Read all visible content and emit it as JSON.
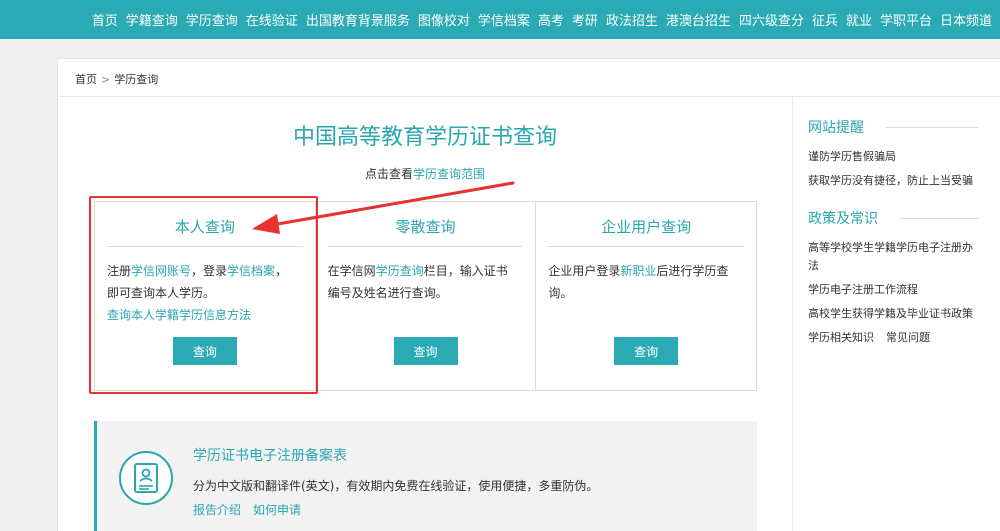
{
  "topnav": {
    "items": [
      "首页",
      "学籍查询",
      "学历查询",
      "在线验证",
      "出国教育背景服务",
      "图像校对",
      "学信档案",
      "高考",
      "考研",
      "政法招生",
      "港澳台招生",
      "四六级查分",
      "征兵",
      "就业",
      "学职平台",
      "日本频道"
    ]
  },
  "breadcrumb": {
    "home": "首页",
    "sep": ">",
    "current": "学历查询"
  },
  "main": {
    "title": "中国高等教育学历证书查询",
    "scope_prefix": "点击查看",
    "scope_link": "学历查询范围"
  },
  "cards": [
    {
      "title": "本人查询",
      "text_1": "注册",
      "link_1": "学信网账号",
      "text_2": "，登录",
      "link_2": "学信档案",
      "text_3": "，即可查询本人学历。",
      "link_3": "查询本人学籍学历信息方法",
      "button": "查询"
    },
    {
      "title": "零散查询",
      "text_1": "在学信网",
      "link_1": "学历查询",
      "text_2": "栏目，输入证书编号及姓名进行查询。",
      "button": "查询"
    },
    {
      "title": "企业用户查询",
      "text_1": "企业用户登录",
      "link_1": "新职业",
      "text_2": "后进行学历查询。",
      "button": "查询"
    }
  ],
  "filing": {
    "title": "学历证书电子注册备案表",
    "desc": "分为中文版和翻译件(英文)，有效期内免费在线验证，使用便捷，多重防伪。",
    "link_1": "报告介绍",
    "link_2": "如何申请"
  },
  "sidebar": {
    "section_1": {
      "heading": "网站提醒",
      "items": [
        "谨防学历售假骗局",
        "获取学历没有捷径，防止上当受骗"
      ]
    },
    "section_2": {
      "heading": "政策及常识",
      "items": [
        "高等学校学生学籍学历电子注册办法",
        "学历电子注册工作流程",
        "高校学生获得学籍及毕业证书政策"
      ],
      "inline_1": "学历相关知识",
      "inline_2": "常见问题"
    }
  },
  "colors": {
    "brand": "#2aaab4",
    "annotation": "#e8322d"
  }
}
